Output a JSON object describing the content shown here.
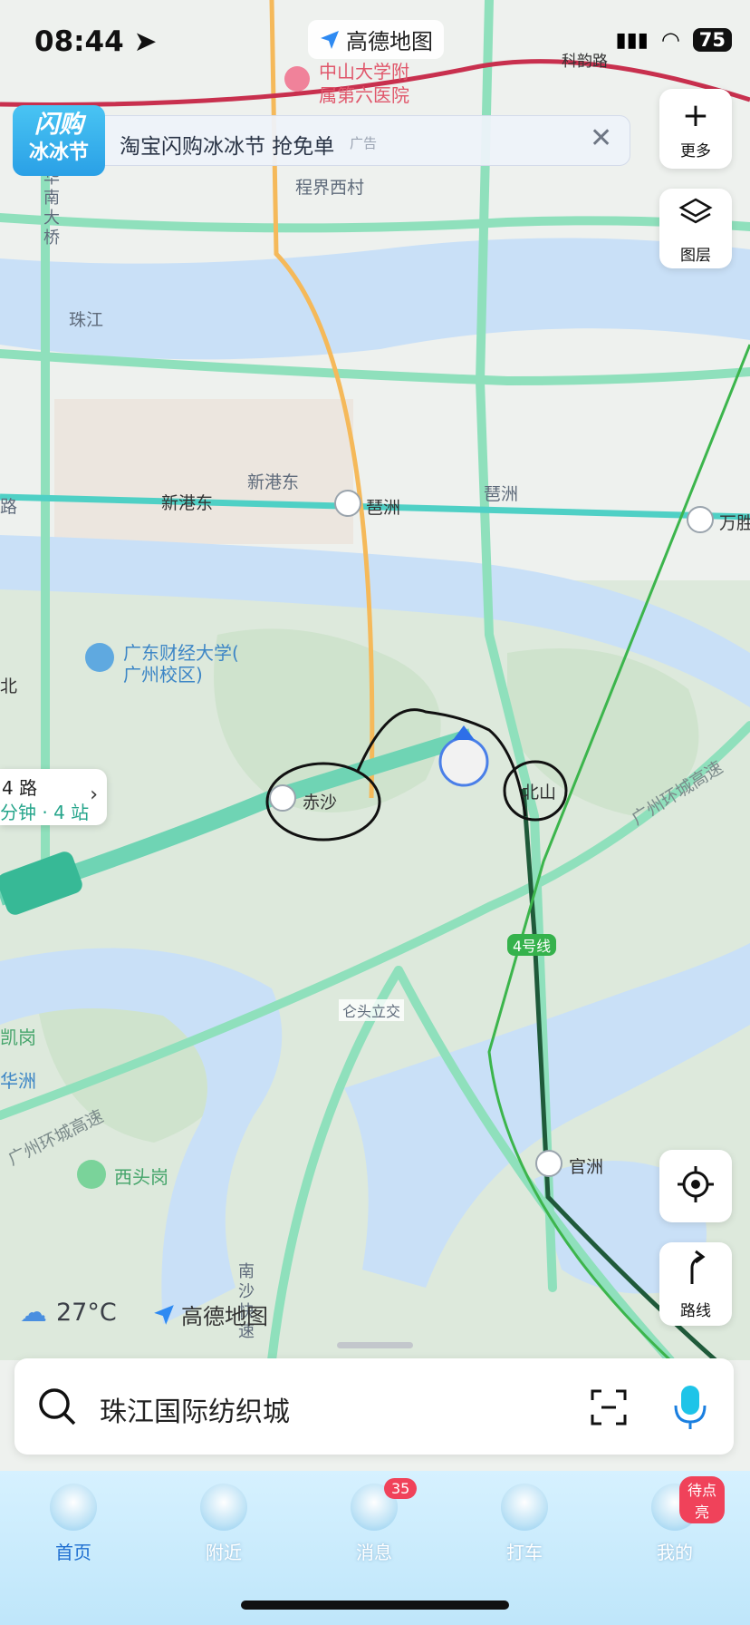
{
  "status": {
    "time": "08:44",
    "battery": "75"
  },
  "top_logo": "高德地图",
  "map_labels": {
    "hospital": "中山大学附\n属第六医院",
    "kenyun": "科韵路",
    "chengjiexi": "程界西村",
    "huanan_bridge": "华\n南\n大\n桥",
    "zhujiang": "珠江",
    "xingangdong_area": "新港东",
    "xingangdong_station": "新港东",
    "pazhou_station": "琶洲",
    "pazhou_area": "琶洲",
    "wansheng": "万胜",
    "lu_left": "路",
    "university": "广东财经大学(\n广州校区)",
    "bei_left": "北",
    "chisha": "赤沙",
    "beishan": "北山",
    "line4": "4号线",
    "huanchenggs1": "广州环城高速",
    "canghou": "仑头立交",
    "gang_left": "凯岗",
    "hua_left": "华洲",
    "huanchenggs2": "广州环城高速",
    "xitougang": "西头岗",
    "guanzhou": "官洲",
    "nansha": "南\n沙\n快\n速"
  },
  "ad": {
    "badge_line1": "闪购",
    "badge_line2": "冰冰节",
    "text": "淘宝闪购冰冰节 抢免单",
    "tag": "广告"
  },
  "side_buttons": {
    "more": "更多",
    "layers": "图层",
    "route": "路线"
  },
  "bus_card": {
    "line1": "4 路",
    "line2": "分钟 · 4 站"
  },
  "weather": {
    "temp": "27°C",
    "brand": "高德地图"
  },
  "search": {
    "value": "珠江国际纺织城"
  },
  "nav": {
    "items": [
      "首页",
      "附近",
      "消息",
      "打车",
      "我的"
    ],
    "message_badge": "35",
    "mine_badge": "待点亮"
  },
  "colors": {
    "water": "#c9e0f7",
    "road": "#7ddbb1",
    "metro_green": "#32b24c",
    "accent": "#1f6fd1"
  }
}
